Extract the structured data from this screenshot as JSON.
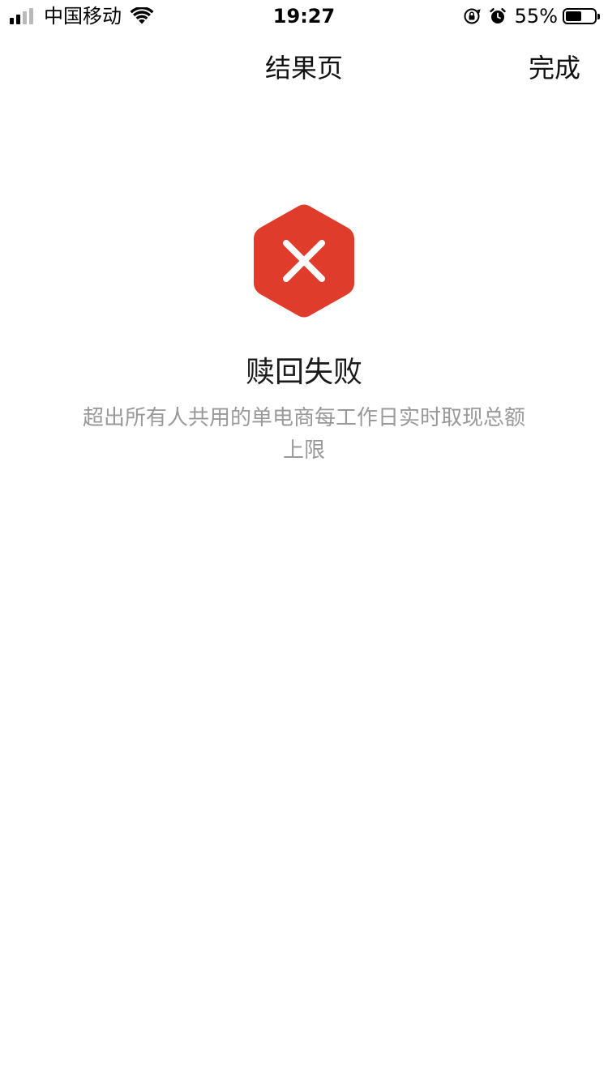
{
  "status_bar": {
    "carrier": "中国移动",
    "time": "19:27",
    "battery_percent": "55%",
    "battery_level": 0.55,
    "icons": [
      "signal-icon",
      "wifi-icon",
      "orientation-lock-icon",
      "alarm-icon",
      "battery-icon"
    ]
  },
  "nav": {
    "title": "结果页",
    "done_label": "完成"
  },
  "result": {
    "icon": "error-hexagon-icon",
    "title": "赎回失败",
    "description": "超出所有人共用的单电商每工作日实时取现总额上限"
  },
  "colors": {
    "error": "#E03C2B",
    "description_text": "#999999"
  }
}
